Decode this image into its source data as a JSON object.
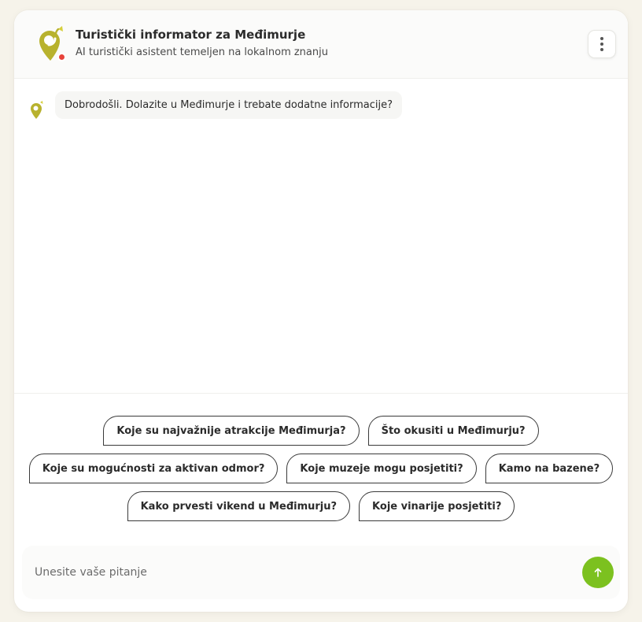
{
  "header": {
    "title": "Turistički informator za Međimurje",
    "subtitle": "AI turistički asistent temeljen na lokalnom znanju",
    "logo_icon": "pin-logo-icon",
    "status_color": "#e8433a",
    "menu_icon": "kebab-menu-icon"
  },
  "chat": {
    "messages": [
      {
        "sender": "bot",
        "text": "Dobrodošli. Dolazite u Međimurje i trebate dodatne informacije?"
      }
    ]
  },
  "suggestions": {
    "rows": [
      [
        "Koje su najvažnije atrakcije Međimurja?",
        "Što okusiti u Međimurju?"
      ],
      [
        "Koje su mogućnosti za aktivan odmor?",
        "Koje muzeje mogu posjetiti?",
        "Kamo na bazene?"
      ],
      [
        "Kako prvesti vikend u Međimurju?",
        "Koje vinarije posjetiti?"
      ]
    ]
  },
  "input": {
    "placeholder": "Unesite vaše pitanje",
    "value": "",
    "send_icon": "arrow-up-icon"
  },
  "colors": {
    "accent": "#7cc11f",
    "logo": "#b8b22e",
    "background": "#f6f3ea"
  }
}
